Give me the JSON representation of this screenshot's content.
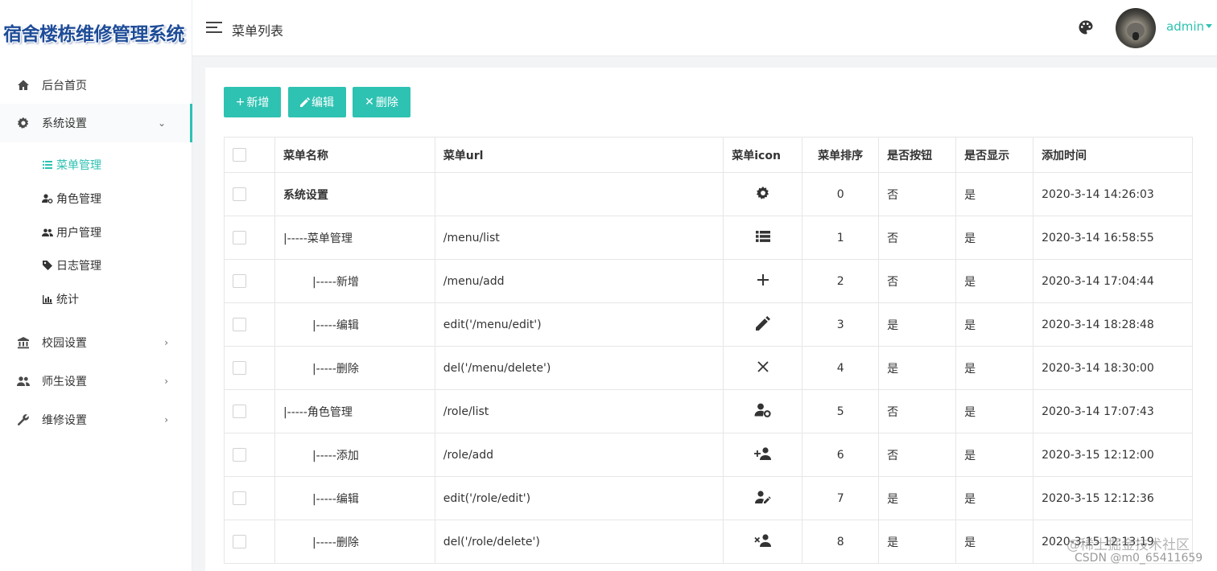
{
  "app": {
    "logo_text": "宿舍楼栋维修管理系统"
  },
  "header": {
    "page_title": "菜单列表",
    "user_name": "admin"
  },
  "sidebar": {
    "items": [
      {
        "label": "后台首页",
        "icon": "home-icon"
      },
      {
        "label": "系统设置",
        "icon": "gear-icon",
        "expanded": true
      },
      {
        "label": "校园设置",
        "icon": "bank-icon"
      },
      {
        "label": "师生设置",
        "icon": "people-icon"
      },
      {
        "label": "维修设置",
        "icon": "wrench-icon"
      }
    ],
    "sub_items": [
      {
        "label": "菜单管理",
        "icon": "list-icon",
        "active": true
      },
      {
        "label": "角色管理",
        "icon": "user-gear-icon"
      },
      {
        "label": "用户管理",
        "icon": "users-icon"
      },
      {
        "label": "日志管理",
        "icon": "tag-icon"
      },
      {
        "label": "统计",
        "icon": "bar-chart-icon"
      }
    ]
  },
  "toolbar": {
    "add_label": "新增",
    "edit_label": "编辑",
    "delete_label": "删除"
  },
  "table": {
    "columns": [
      "菜单名称",
      "菜单url",
      "菜单icon",
      "菜单排序",
      "是否按钮",
      "是否显示",
      "添加时间"
    ],
    "rows": [
      {
        "name": "系统设置",
        "url": "",
        "icon": "gear-icon",
        "sort": "0",
        "is_button": "否",
        "is_show": "是",
        "time": "2020-3-14 14:26:03"
      },
      {
        "name": "|-----菜单管理",
        "url": "/menu/list",
        "icon": "list-icon",
        "sort": "1",
        "is_button": "否",
        "is_show": "是",
        "time": "2020-3-14 16:58:55"
      },
      {
        "name": "|-----新增",
        "url": "/menu/add",
        "icon": "plus-icon",
        "sort": "2",
        "is_button": "否",
        "is_show": "是",
        "time": "2020-3-14 17:04:44"
      },
      {
        "name": "|-----编辑",
        "url": "edit('/menu/edit')",
        "icon": "pencil-icon",
        "sort": "3",
        "is_button": "是",
        "is_show": "是",
        "time": "2020-3-14 18:28:48"
      },
      {
        "name": "|-----删除",
        "url": "del('/menu/delete')",
        "icon": "close-icon",
        "sort": "4",
        "is_button": "是",
        "is_show": "是",
        "time": "2020-3-14 18:30:00"
      },
      {
        "name": "|-----角色管理",
        "url": "/role/list",
        "icon": "user-gear-icon",
        "sort": "5",
        "is_button": "否",
        "is_show": "是",
        "time": "2020-3-14 17:07:43"
      },
      {
        "name": "|-----添加",
        "url": "/role/add",
        "icon": "user-add-icon",
        "sort": "6",
        "is_button": "否",
        "is_show": "是",
        "time": "2020-3-15 12:12:00"
      },
      {
        "name": "|-----编辑",
        "url": "edit('/role/edit')",
        "icon": "user-edit-icon",
        "sort": "7",
        "is_button": "是",
        "is_show": "是",
        "time": "2020-3-15 12:12:36"
      },
      {
        "name": "|-----删除",
        "url": "del('/role/delete')",
        "icon": "user-remove-icon",
        "sort": "8",
        "is_button": "是",
        "is_show": "是",
        "time": "2020-3-15 12:13:19"
      }
    ]
  },
  "watermark": {
    "line1": "@稀土掘金技术社区",
    "line2": "CSDN @m0_65411659"
  },
  "colors": {
    "accent": "#2ec2b2",
    "no": "#5ab0e8",
    "yes": "#23b07d"
  }
}
